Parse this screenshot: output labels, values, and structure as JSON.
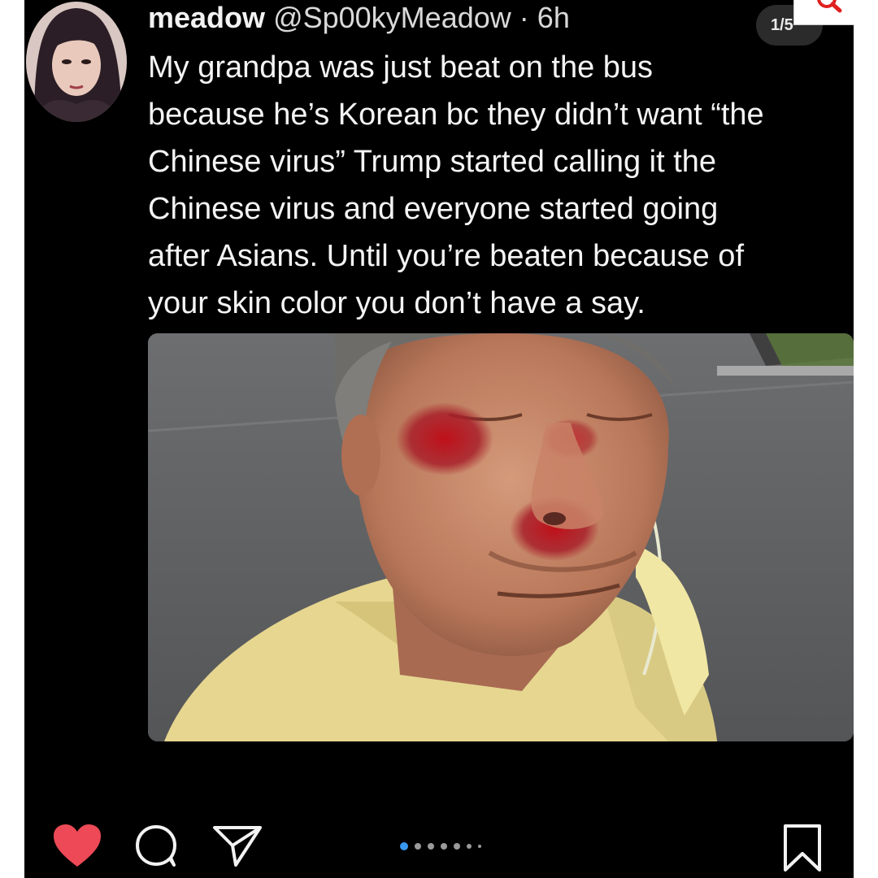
{
  "post": {
    "author": {
      "display_name": "meadow",
      "handle": "@Sp00kyMeadow",
      "separator": "·",
      "time": "6h"
    },
    "carousel_indicator": "1/5",
    "text_lines": [
      "My grandpa was just beat on the bus",
      "because he’s Korean bc they didn’t want “the",
      "Chinese virus” Trump started calling it the",
      "Chinese virus and everyone started going",
      "after Asians. Until you’re beaten because of",
      "your skin color you don’t have a say."
    ]
  },
  "actions": {
    "icons": [
      "heart-icon",
      "comment-icon",
      "share-icon",
      "bookmark-icon"
    ],
    "liked": true,
    "carousel_dots": {
      "count": 7,
      "active_index": 0
    }
  },
  "colors": {
    "background": "#000000",
    "text": "#f4f4f4",
    "like_red": "#ed4956",
    "active_dot_blue": "#3897f0",
    "inactive_dot": "#9a9a9a"
  }
}
